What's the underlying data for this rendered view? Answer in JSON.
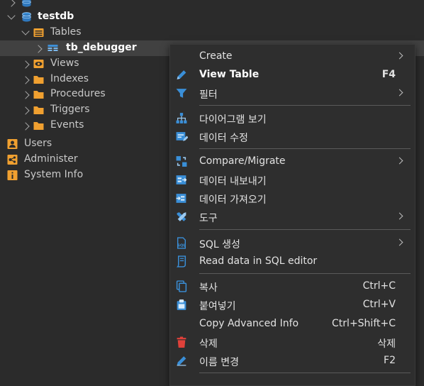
{
  "tree": {
    "db_name": "testdb",
    "tables_label": "Tables",
    "selected_table": "tb_debugger",
    "folders": [
      "Views",
      "Indexes",
      "Procedures",
      "Triggers",
      "Events"
    ],
    "sections": [
      "Users",
      "Administer",
      "System Info"
    ]
  },
  "menu": {
    "create": "Create",
    "view_table": "View Table",
    "view_table_shortcut": "F4",
    "filter": "필터",
    "diagram": "다이어그램 보기",
    "edit_data": "데이터 수정",
    "compare": "Compare/Migrate",
    "export": "데이터 내보내기",
    "import": "데이터 가져오기",
    "tools": "도구",
    "sql_gen": "SQL 생성",
    "read_sql": "Read data in SQL editor",
    "copy": "복사",
    "copy_shortcut": "Ctrl+C",
    "paste": "붙여넣기",
    "paste_shortcut": "Ctrl+V",
    "copy_adv": "Copy Advanced Info",
    "copy_adv_shortcut": "Ctrl+Shift+C",
    "delete": "삭제",
    "delete_shortcut": "삭제",
    "rename": "이름 변경",
    "rename_shortcut": "F2"
  },
  "colors": {
    "folder": "#f0a030",
    "db_icon": "#3d8fd6",
    "menu_icon_blue": "#3a8fd8",
    "delete_icon": "#e0413a"
  }
}
